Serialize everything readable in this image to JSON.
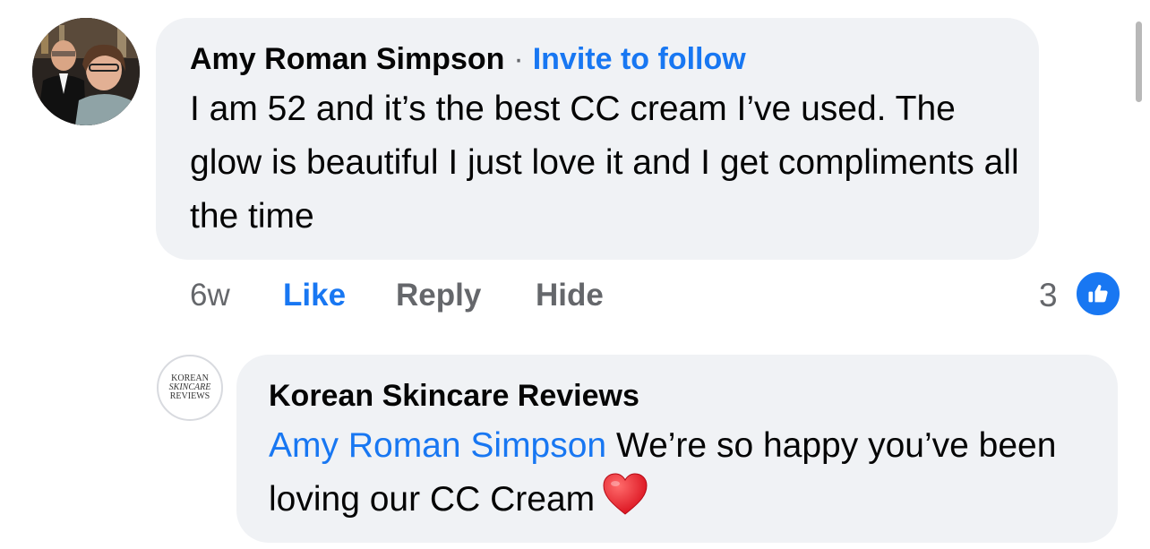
{
  "comment": {
    "author": "Amy Roman Simpson",
    "separator": "·",
    "invite_label": "Invite to follow",
    "text": "I am 52 and it’s the best CC cream I’ve used. The glow is beautiful I just love it and I get compliments all the time",
    "time": "6w",
    "like_label": "Like",
    "reply_label": "Reply",
    "hide_label": "Hide",
    "reaction_count": "3",
    "reaction_icon": "thumbs-up-icon",
    "reaction_color": "#1877f2"
  },
  "reply": {
    "author": "Korean Skincare Reviews",
    "avatar_text": [
      "KOREAN",
      "SKINCARE",
      "REVIEWS"
    ],
    "mention": "Amy Roman Simpson",
    "text": " We’re so happy you’ve been loving our CC Cream",
    "emoji_icon": "red-heart-icon"
  },
  "colors": {
    "link_blue": "#1877f2",
    "bubble_bg": "#f0f2f5",
    "secondary_text": "#65676b"
  }
}
